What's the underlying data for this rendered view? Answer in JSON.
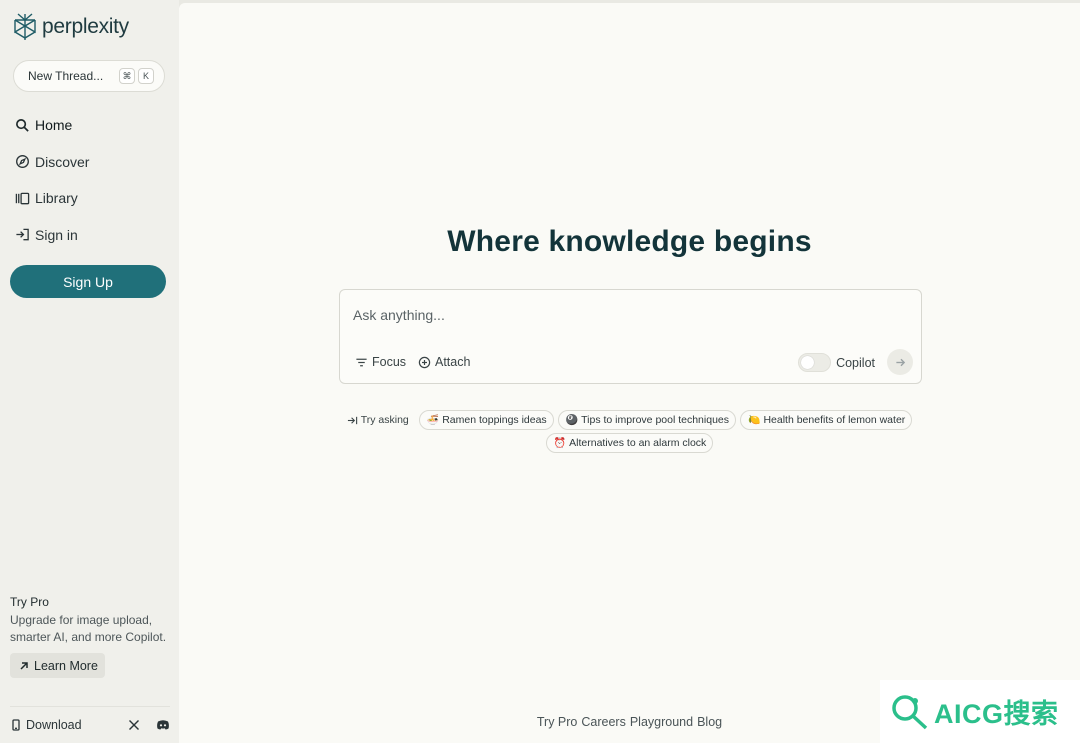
{
  "brand": {
    "name": "perplexity",
    "color": "#20707a"
  },
  "sidebar": {
    "new_thread": {
      "label": "New Thread...",
      "keys": [
        "⌘",
        "K"
      ]
    },
    "nav": [
      {
        "label": "Home",
        "icon": "search-icon"
      },
      {
        "label": "Discover",
        "icon": "compass-icon"
      },
      {
        "label": "Library",
        "icon": "library-icon"
      },
      {
        "label": "Sign in",
        "icon": "sign-in-icon"
      }
    ],
    "signup_label": "Sign Up",
    "promo": {
      "title": "Try Pro",
      "description": "Upgrade for image upload, smarter AI, and more Copilot.",
      "button": "Learn More"
    },
    "footer": {
      "download": "Download"
    }
  },
  "main": {
    "headline": "Where knowledge begins",
    "ask": {
      "placeholder": "Ask anything...",
      "focus_label": "Focus",
      "attach_label": "Attach",
      "copilot_label": "Copilot"
    },
    "try_asking": "Try asking",
    "suggestions": [
      {
        "emoji": "🍜",
        "label": "Ramen toppings ideas"
      },
      {
        "emoji": "🎱",
        "label": "Tips to improve pool techniques"
      },
      {
        "emoji": "🍋",
        "label": "Health benefits of lemon water"
      },
      {
        "emoji": "⏰",
        "label": "Alternatives to an alarm clock"
      }
    ],
    "footer_links": [
      "Try Pro",
      "Careers",
      "Playground",
      "Blog"
    ]
  },
  "watermark": {
    "text": "AICG搜索",
    "color": "#2bbf8b"
  }
}
